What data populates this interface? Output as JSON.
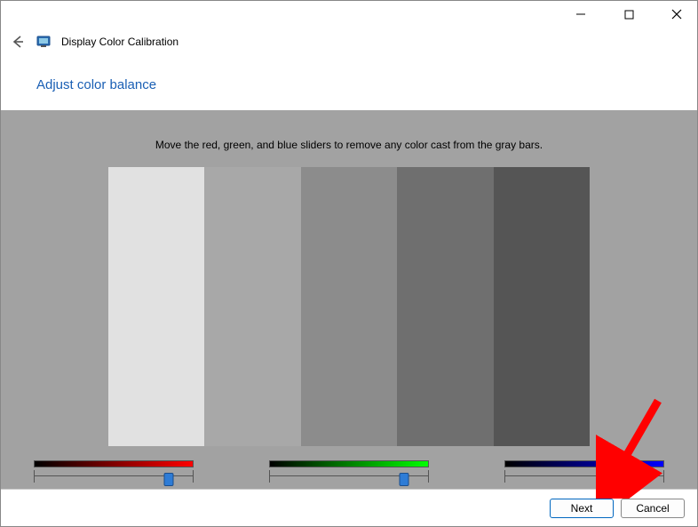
{
  "window": {
    "title": "Display Color Calibration"
  },
  "page": {
    "heading": "Adjust color balance",
    "instruction": "Move the red, green, and blue sliders to remove any color cast from the gray bars."
  },
  "graybars": {
    "colors": [
      "#e1e1e1",
      "#a8a8a8",
      "#8c8c8c",
      "#6f6f6f",
      "#555555"
    ]
  },
  "sliders": {
    "red": {
      "gradient_from": "#000000",
      "gradient_to": "#ff0000",
      "value_pct": 85
    },
    "green": {
      "gradient_from": "#000000",
      "gradient_to": "#00ff00",
      "value_pct": 85
    },
    "blue": {
      "gradient_from": "#000000",
      "gradient_to": "#0000ff",
      "value_pct": 85
    }
  },
  "buttons": {
    "next": "Next",
    "cancel": "Cancel"
  }
}
